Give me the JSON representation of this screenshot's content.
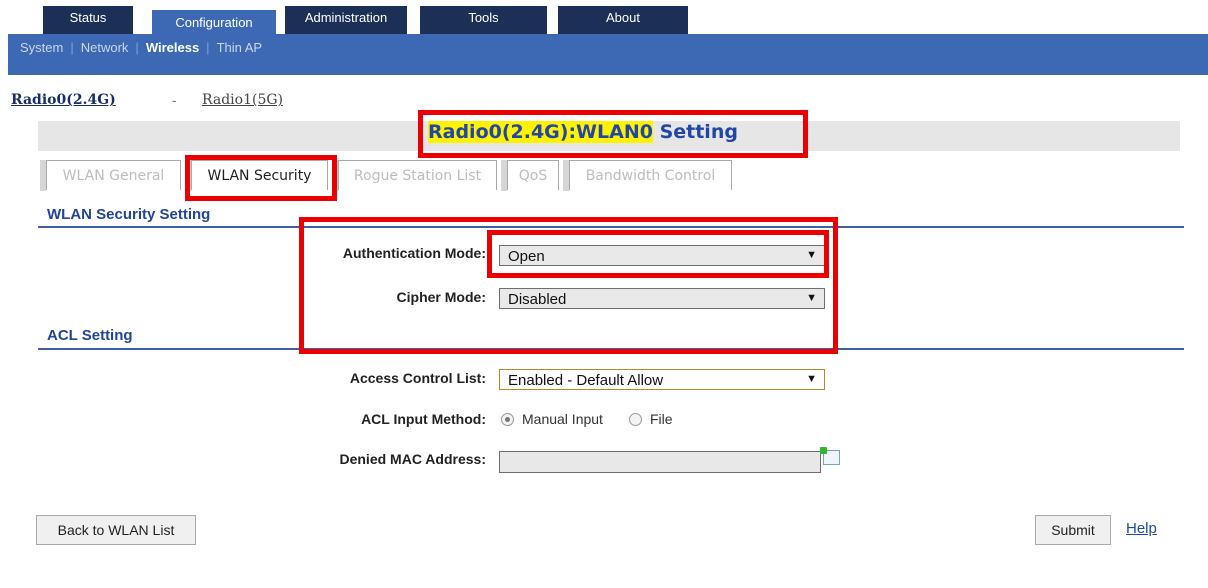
{
  "main_tabs": [
    {
      "label": "Status"
    },
    {
      "label": "Configuration"
    },
    {
      "label": "Administration"
    },
    {
      "label": "Tools"
    },
    {
      "label": "About"
    }
  ],
  "sub_nav": {
    "items": [
      {
        "label": "System"
      },
      {
        "label": "Network"
      },
      {
        "label": "Wireless"
      },
      {
        "label": "Thin AP"
      }
    ]
  },
  "radio_tabs": {
    "radio0": "Radio0(2.4G)",
    "separator": "-",
    "radio1": "Radio1(5G)"
  },
  "page_title": {
    "highlighted": "Radio0(2.4G):WLAN0",
    "rest": " Setting"
  },
  "section_tabs": [
    {
      "label": "WLAN General"
    },
    {
      "label": "WLAN Security"
    },
    {
      "label": "Rogue Station List"
    },
    {
      "label": "QoS"
    },
    {
      "label": "Bandwidth Control"
    }
  ],
  "security": {
    "title": "WLAN Security Setting",
    "auth_label": "Authentication Mode:",
    "auth_value": "Open",
    "cipher_label": "Cipher Mode:",
    "cipher_value": "Disabled"
  },
  "acl": {
    "title": "ACL Setting",
    "list_label": "Access Control List:",
    "list_value": "Enabled - Default Allow",
    "method_label": "ACL Input Method:",
    "method_manual": "Manual Input",
    "method_file": "File",
    "denied_label": "Denied MAC Address:",
    "denied_value": ""
  },
  "buttons": {
    "back": "Back to WLAN List",
    "submit": "Submit",
    "help": "Help"
  },
  "icons": {
    "dropdown": "▼"
  },
  "colors": {
    "nav_dark": "#1c2f57",
    "nav_blue": "#3c68b4",
    "title_blue": "#1f46a8",
    "highlight": "#fff200",
    "annotation_red": "#ea0000"
  }
}
